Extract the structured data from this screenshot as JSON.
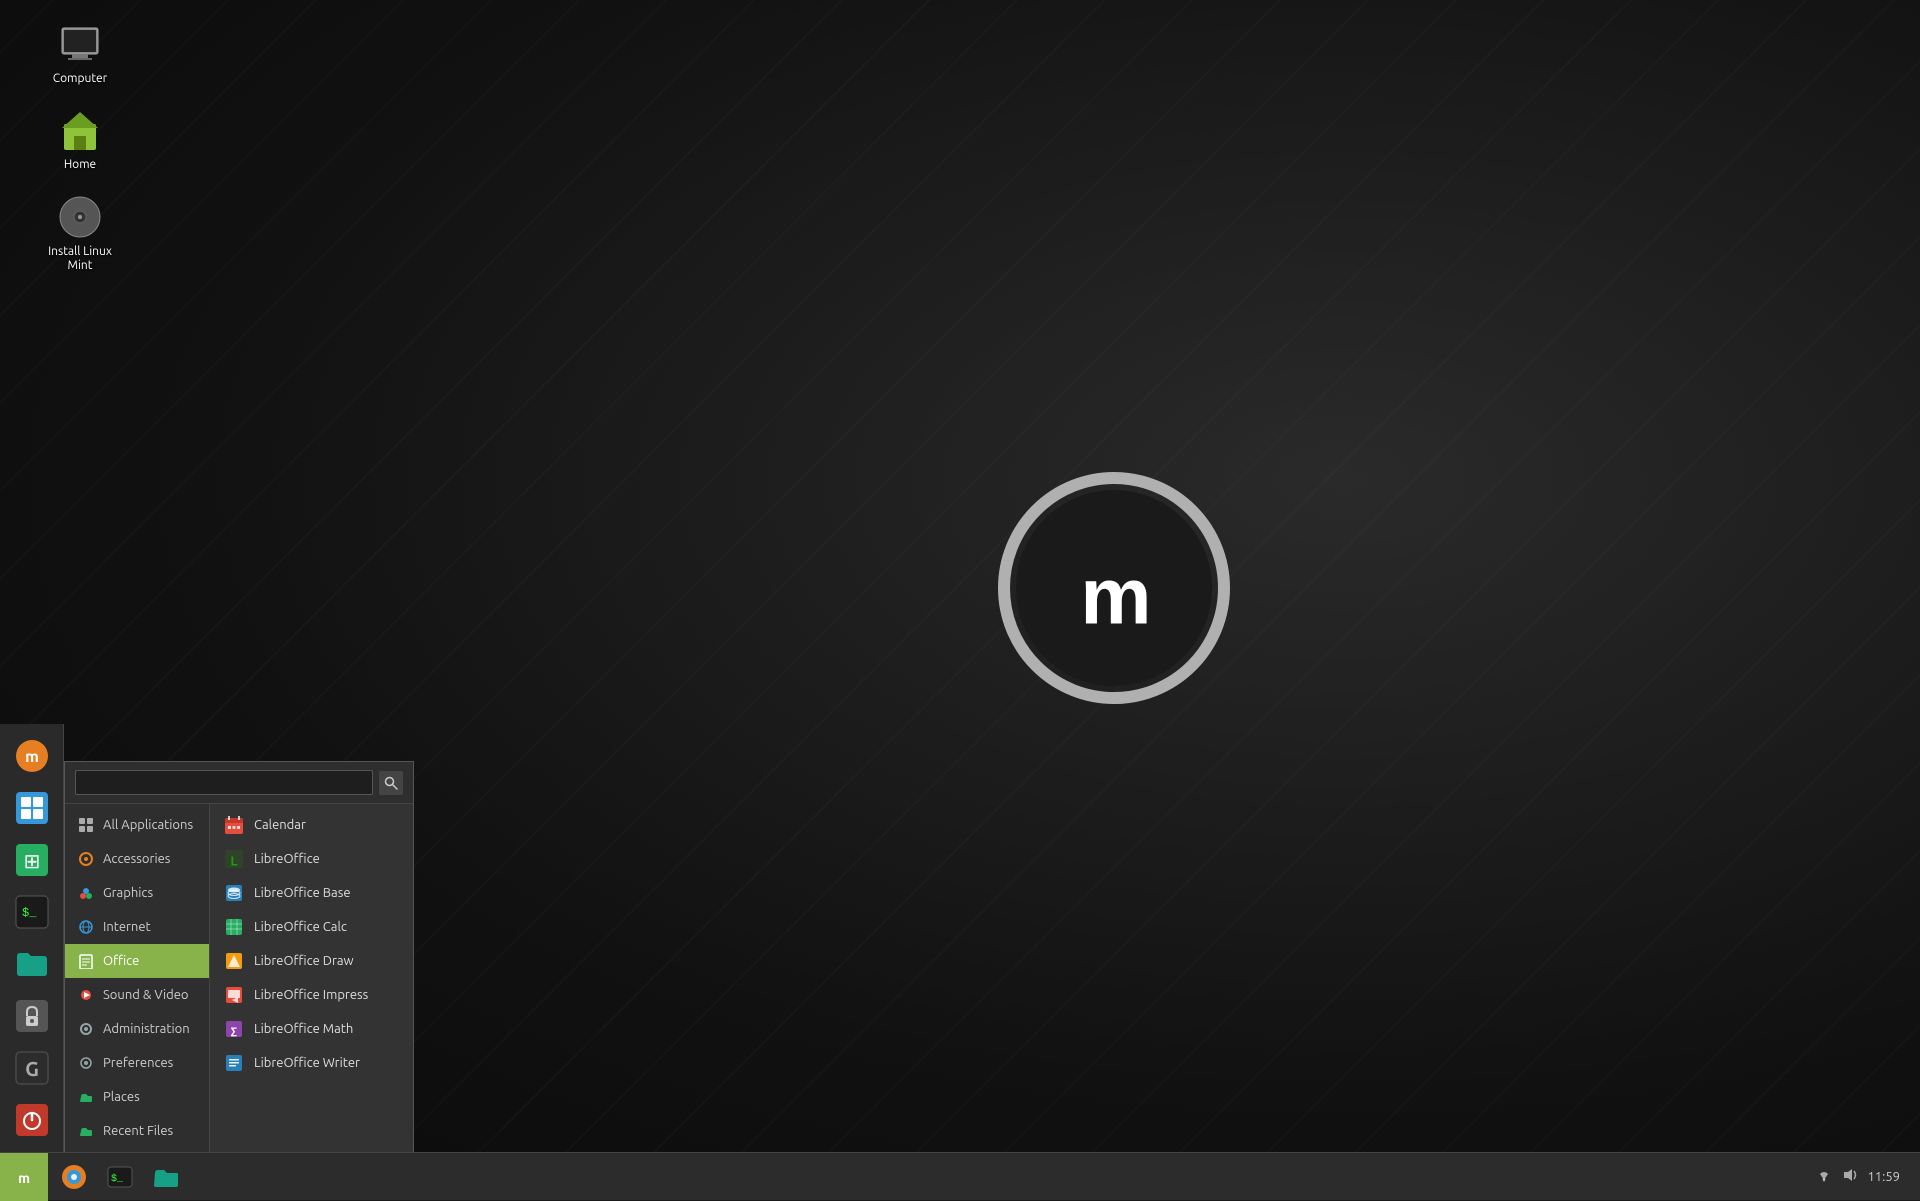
{
  "desktop": {
    "icons": [
      {
        "id": "computer",
        "label": "Computer",
        "icon": "computer"
      },
      {
        "id": "home",
        "label": "Home",
        "icon": "home"
      },
      {
        "id": "install",
        "label": "Install Linux Mint",
        "icon": "disc"
      }
    ]
  },
  "taskbar": {
    "start_color": "#87b34a",
    "items": [
      {
        "id": "mint-menu",
        "icon": "mint"
      },
      {
        "id": "terminal",
        "icon": "terminal"
      },
      {
        "id": "files",
        "icon": "files"
      },
      {
        "id": "firefox",
        "icon": "firefox"
      }
    ],
    "systray": {
      "network": "network-icon",
      "sound": "sound-icon",
      "time": "11:59"
    }
  },
  "sidebar": {
    "icons": [
      {
        "id": "mint-home",
        "icon": "mint-orange"
      },
      {
        "id": "software-manager",
        "icon": "grid"
      },
      {
        "id": "synaptic",
        "icon": "package"
      },
      {
        "id": "terminal-side",
        "icon": "terminal-green"
      },
      {
        "id": "folder-side",
        "icon": "folder-teal"
      },
      {
        "id": "lock",
        "icon": "lock"
      },
      {
        "id": "grub",
        "icon": "grub-g"
      },
      {
        "id": "power",
        "icon": "power-red"
      }
    ]
  },
  "menu": {
    "search_placeholder": "",
    "categories": [
      {
        "id": "all",
        "label": "All Applications",
        "icon": "grid-icon",
        "active": false
      },
      {
        "id": "accessories",
        "label": "Accessories",
        "icon": "accessories-icon",
        "active": false
      },
      {
        "id": "graphics",
        "label": "Graphics",
        "icon": "graphics-icon",
        "active": false
      },
      {
        "id": "internet",
        "label": "Internet",
        "icon": "internet-icon",
        "active": false
      },
      {
        "id": "office",
        "label": "Office",
        "icon": "office-icon",
        "active": true
      },
      {
        "id": "sound-video",
        "label": "Sound & Video",
        "icon": "sound-icon",
        "active": false
      },
      {
        "id": "administration",
        "label": "Administration",
        "icon": "admin-icon",
        "active": false
      },
      {
        "id": "preferences",
        "label": "Preferences",
        "icon": "prefs-icon",
        "active": false
      },
      {
        "id": "places",
        "label": "Places",
        "icon": "places-icon",
        "active": false
      },
      {
        "id": "recent",
        "label": "Recent Files",
        "icon": "recent-icon",
        "active": false
      }
    ],
    "apps": [
      {
        "id": "calendar",
        "label": "Calendar",
        "color": "#e74c3c",
        "icon": "calendar"
      },
      {
        "id": "libreoffice",
        "label": "LibreOffice",
        "color": "#2980b9",
        "icon": "lo"
      },
      {
        "id": "lo-base",
        "label": "LibreOffice Base",
        "color": "#2980b9",
        "icon": "lo-base"
      },
      {
        "id": "lo-calc",
        "label": "LibreOffice Calc",
        "color": "#27ae60",
        "icon": "lo-calc"
      },
      {
        "id": "lo-draw",
        "label": "LibreOffice Draw",
        "color": "#f39c12",
        "icon": "lo-draw"
      },
      {
        "id": "lo-impress",
        "label": "LibreOffice Impress",
        "color": "#e74c3c",
        "icon": "lo-impress"
      },
      {
        "id": "lo-math",
        "label": "LibreOffice Math",
        "color": "#8e44ad",
        "icon": "lo-math"
      },
      {
        "id": "lo-writer",
        "label": "LibreOffice Writer",
        "color": "#2980b9",
        "icon": "lo-writer"
      }
    ]
  }
}
